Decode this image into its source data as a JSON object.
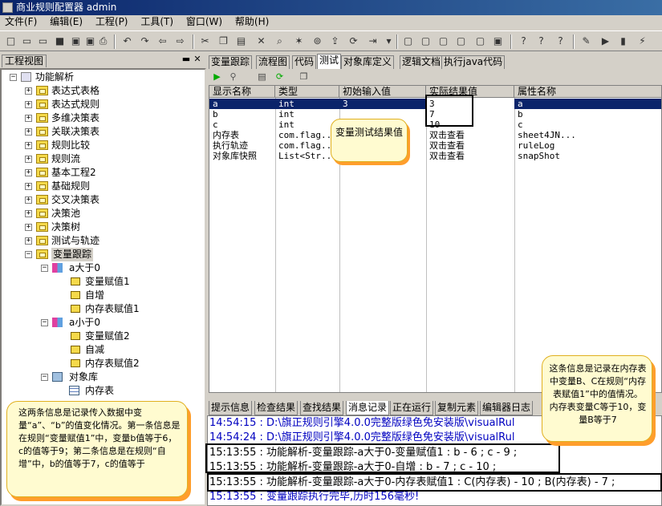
{
  "window": {
    "title": "商业规则配置器 admin"
  },
  "menu": [
    "文件(F)",
    "编辑(E)",
    "工程(P)",
    "工具(T)",
    "窗口(W)",
    "帮助(H)"
  ],
  "toolbar_icons": [
    "new-icon",
    "open-icon",
    "open-folder-icon",
    "save-icon",
    "save-all-icon",
    "save-as-icon",
    "print-icon",
    "undo-icon",
    "redo-icon",
    "back-icon",
    "forward-icon",
    "cut-icon",
    "copy-icon",
    "paste-icon",
    "delete-icon",
    "find-icon",
    "wand-icon",
    "binoculars-icon",
    "export-icon",
    "refresh-icon",
    "indent-icon",
    "dropdown-icon",
    "tool-a-icon",
    "tool-b-icon",
    "tool-c-icon",
    "tool-d-icon",
    "tool-e-icon",
    "tool-f-icon",
    "help-a-icon",
    "help-b-icon",
    "help-c-icon",
    "edit-icon",
    "run-icon",
    "debug-icon",
    "chart-icon"
  ],
  "left_panel": {
    "tab": "工程视图",
    "tree": {
      "root": "功能解析",
      "items": [
        "表达式表格",
        "表达式规则",
        "多维决策表",
        "关联决策表",
        "规则比较",
        "规则流",
        "基本工程2",
        "基础规则",
        "交叉决策表",
        "决策池",
        "决策树",
        "测试与轨迹",
        "变量跟踪"
      ],
      "branch1": {
        "label": "a大于0",
        "children": [
          "变量赋值1",
          "自增",
          "内存表赋值1"
        ]
      },
      "branch2": {
        "label": "a小于0",
        "children": [
          "变量赋值2",
          "自减",
          "内存表赋值2"
        ]
      },
      "objlib": {
        "label": "对象库",
        "children": [
          "内存表"
        ]
      }
    }
  },
  "content_tabs": [
    "变量跟踪",
    "流程图",
    "代码",
    "测试",
    "对象库定义",
    "逻辑文档",
    "执行java代码"
  ],
  "grid": {
    "headers": [
      "显示名称",
      "类型",
      "初始输入值",
      "实际结果值",
      "属性名称"
    ],
    "rows": [
      [
        "a",
        "int",
        "3",
        "3",
        "a"
      ],
      [
        "b",
        "int",
        "",
        "7",
        "b"
      ],
      [
        "c",
        "int",
        "",
        "10",
        "c"
      ],
      [
        "内存表",
        "com.flag...",
        "",
        "双击查看",
        "sheet4JN..."
      ],
      [
        "执行轨迹",
        "com.flag...",
        "",
        "双击查看",
        "ruleLog"
      ],
      [
        "对象库快照",
        "List<Str...",
        "",
        "双击查看",
        "snapShot"
      ]
    ]
  },
  "callout_result": "变量测试结果值",
  "bottom_tabs": [
    "提示信息",
    "检查结果",
    "查找结果",
    "消息记录",
    "正在运行",
    "复制元素",
    "编辑器日志"
  ],
  "messages": [
    {
      "text": "14:54:15 : D:\\旗正规则引擎4.0.0完整版绿色免安装版\\visualRul",
      "color": "#0000c0"
    },
    {
      "text": "14:54:24 : D:\\旗正规则引擎4.0.0完整版绿色免安装版\\visualRul",
      "color": "#0000c0"
    },
    {
      "text": "15:13:55 : 功能解析-变量跟踪-a大于0-变量赋值1 : b - 6 ; c - 9 ;",
      "color": "#000000"
    },
    {
      "text": "15:13:55 : 功能解析-变量跟踪-a大于0-自增 : b - 7 ; c - 10 ;",
      "color": "#000000"
    },
    {
      "text": "15:13:55 : 功能解析-变量跟踪-a大于0-内存表赋值1 : C(内存表) - 10 ; B(内存表) - 7 ;",
      "color": "#000000"
    },
    {
      "text": "15:13:55 : 变量跟踪执行完毕,历时156毫秒!",
      "color": "#0000c0"
    }
  ],
  "callout_left": "这两条信息是记录传入数据中变量“a”、“b”的值变化情况。第一条信息是在规则“变量赋值1”中，变量b值等于6，c的值等于9；第二条信息是在规则“自增”中，b的值等于7，c的值等于",
  "callout_right": "这条信息是记录在内存表中变量B、C在规则“内存表赋值1”中的值情况。内存表变量C等于10，变量B等于7",
  "colors": {
    "titlebar": "#0a246a",
    "selection": "#0a246a",
    "callout_bg": "#fffbd0",
    "callout_shadow": "#ff9e2c",
    "log_blue": "#0000c0"
  }
}
